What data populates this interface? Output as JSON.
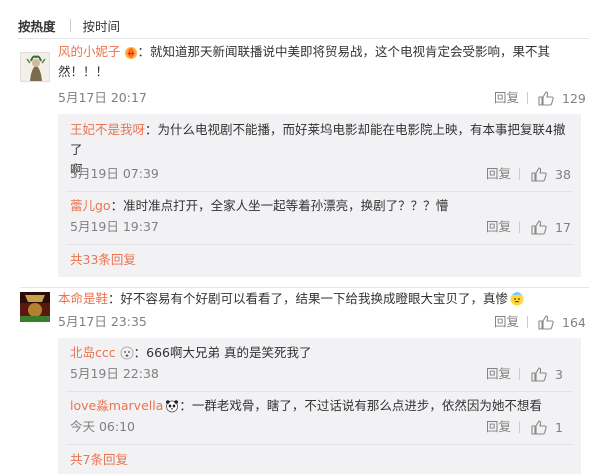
{
  "sort_tabs": {
    "hot": "按热度",
    "time": "按时间"
  },
  "colors": {
    "accent": "#eb7350",
    "meta": "#808080",
    "sub_bg": "#f2f2f5"
  },
  "comments": [
    {
      "user": "风的小妮子",
      "badge_icon": "fire-emoji-icon",
      "text_line1": "：就知道那天新闻联播说中美即将贸易战，这个电视肯定会受影响，果不其",
      "text_line2": "然！！！",
      "time": "5月17日 20:17",
      "reply_label": "回复",
      "likes": "129",
      "replies": [
        {
          "user": "王妃不是我呀",
          "text_line1": "：为什么电视剧不能播，而好莱坞电影却能在电影院上映，有本事把复联4撤了",
          "text_line2": "啊",
          "time": "5月19日 07:39",
          "reply_label": "回复",
          "likes": "38"
        },
        {
          "user": "蕾儿go",
          "text": "：准时准点打开，全家人坐一起等着孙漂亮，换剧了？？？懵",
          "time": "5月19日 19:37",
          "reply_label": "回复",
          "likes": "17"
        }
      ],
      "more_label": "共33条回复"
    },
    {
      "user": "本命是鞋",
      "text": "：好不容易有个好剧可以看看了，结果一下给我换成瞪眼大宝贝了，真惨",
      "badge_icon": "sweat-emoji-icon",
      "time": "5月17日 23:35",
      "reply_label": "回复",
      "likes": "164",
      "replies": [
        {
          "user": "北岛ccc",
          "badge_icon": "shocked-emoji-icon",
          "text": "：666啊大兄弟 真的是笑死我了",
          "time": "5月19日 22:38",
          "reply_label": "回复",
          "likes": "3"
        },
        {
          "user": "love淼marvella",
          "badge_icon": "panda-emoji-icon",
          "text": "：一群老戏骨，瞎了，不过话说有那么点进步，依然因为她不想看",
          "time": "今天 06:10",
          "reply_label": "回复",
          "likes": "1"
        }
      ],
      "more_label": "共7条回复"
    }
  ]
}
